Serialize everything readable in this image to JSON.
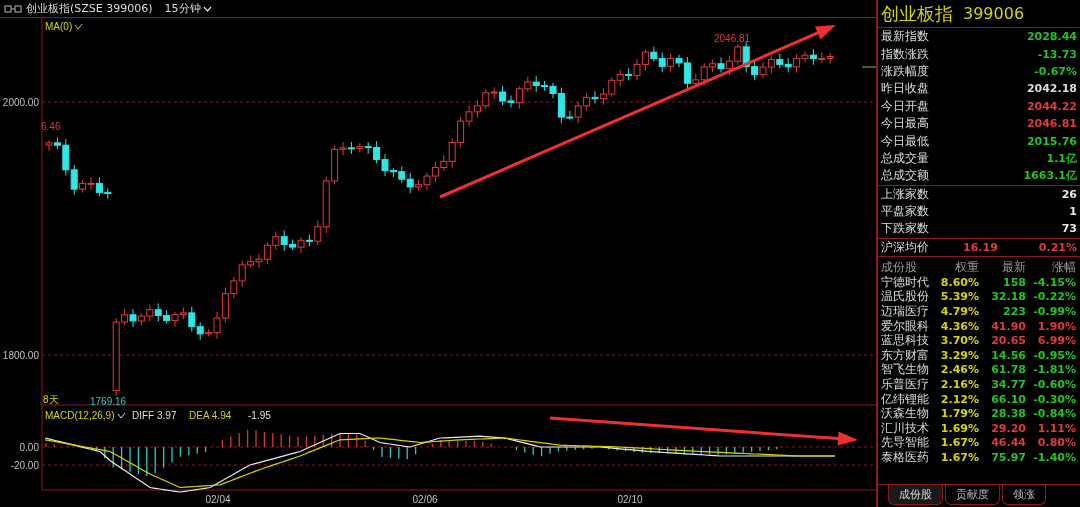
{
  "header": {
    "title": "创业板指(SZSE 399006)",
    "period": "15分钟"
  },
  "chart": {
    "indicator": "MA(0)",
    "y_labels": [
      "2000.00",
      "1800.00"
    ],
    "high_label": "2046.81",
    "low_label": "1769.16",
    "cut_label": "6.46",
    "days_label": "8天",
    "x_labels": [
      "02/04",
      "02/06",
      "02/10"
    ]
  },
  "macd": {
    "name": "MACD(12,26,9)",
    "diff": "DIFF 3.97",
    "dea": "DEA 4.94",
    "value": "-1.95",
    "y_labels": [
      "0.00",
      "-20.00"
    ]
  },
  "quote": {
    "name": "创业板指",
    "code": "399006",
    "stats": [
      {
        "label": "最新指数",
        "value": "2028.44",
        "color": "#22c322"
      },
      {
        "label": "指数涨跌",
        "value": "-13.73",
        "color": "#22c322"
      },
      {
        "label": "涨跌幅度",
        "value": "-0.67%",
        "color": "#22c322"
      },
      {
        "label": "昨日收盘",
        "value": "2042.18",
        "color": "#dcdcdc"
      },
      {
        "label": "今日开盘",
        "value": "2044.22",
        "color": "#e03a3a"
      },
      {
        "label": "今日最高",
        "value": "2046.81",
        "color": "#e03a3a"
      },
      {
        "label": "今日最低",
        "value": "2015.76",
        "color": "#22c322"
      },
      {
        "label": "总成交量",
        "value": "1.1亿",
        "color": "#22c322"
      },
      {
        "label": "总成交额",
        "value": "1663.1亿",
        "color": "#22c322"
      }
    ],
    "breadth": [
      {
        "label": "上涨家数",
        "value": "26"
      },
      {
        "label": "平盘家数",
        "value": "1"
      },
      {
        "label": "下跌家数",
        "value": "73"
      }
    ],
    "average": {
      "label": "沪深均价",
      "price": "16.19",
      "change": "0.21%"
    }
  },
  "components": {
    "columns": [
      "成份股",
      "权重",
      "最新",
      "涨幅"
    ],
    "rows": [
      {
        "name": "宁德时代",
        "weight": "8.60%",
        "price": "158",
        "change": "-4.15%",
        "color": "#22c322"
      },
      {
        "name": "温氏股份",
        "weight": "5.39%",
        "price": "32.18",
        "change": "-0.22%",
        "color": "#22c322"
      },
      {
        "name": "迈瑞医疗",
        "weight": "4.79%",
        "price": "223",
        "change": "-0.99%",
        "color": "#22c322"
      },
      {
        "name": "爱尔眼科",
        "weight": "4.36%",
        "price": "41.90",
        "change": "1.90%",
        "color": "#e03a3a"
      },
      {
        "name": "蓝思科技",
        "weight": "3.70%",
        "price": "20.65",
        "change": "6.99%",
        "color": "#e03a3a"
      },
      {
        "name": "东方财富",
        "weight": "3.29%",
        "price": "14.56",
        "change": "-0.95%",
        "color": "#22c322"
      },
      {
        "name": "智飞生物",
        "weight": "2.46%",
        "price": "61.78",
        "change": "-1.81%",
        "color": "#22c322"
      },
      {
        "name": "乐普医疗",
        "weight": "2.16%",
        "price": "34.77",
        "change": "-0.60%",
        "color": "#22c322"
      },
      {
        "name": "亿纬锂能",
        "weight": "2.12%",
        "price": "66.10",
        "change": "-0.30%",
        "color": "#22c322"
      },
      {
        "name": "沃森生物",
        "weight": "1.79%",
        "price": "28.38",
        "change": "-0.84%",
        "color": "#22c322"
      },
      {
        "name": "汇川技术",
        "weight": "1.69%",
        "price": "29.20",
        "change": "1.11%",
        "color": "#e03a3a"
      },
      {
        "name": "先导智能",
        "weight": "1.67%",
        "price": "46.44",
        "change": "0.80%",
        "color": "#e03a3a"
      },
      {
        "name": "泰格医药",
        "weight": "1.67%",
        "price": "75.97",
        "change": "-1.40%",
        "color": "#22c322"
      }
    ]
  },
  "tabs": [
    {
      "label": "成份股",
      "selected": true
    },
    {
      "label": "贡献度",
      "selected": false
    },
    {
      "label": "领涨",
      "selected": false
    }
  ]
}
